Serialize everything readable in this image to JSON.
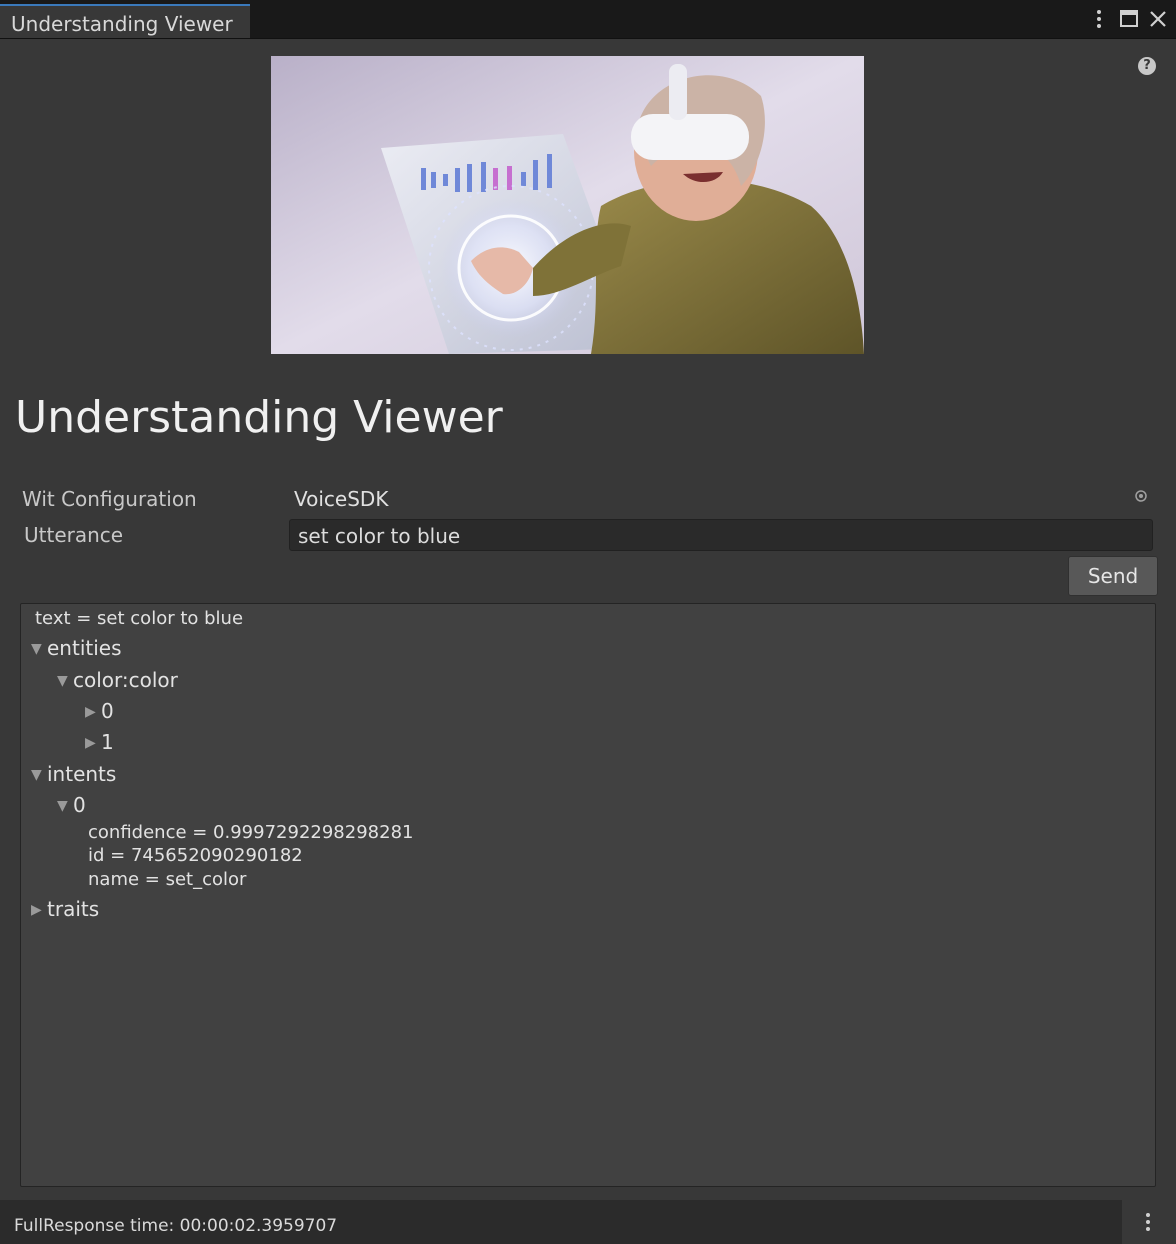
{
  "window": {
    "tab_title": "Understanding Viewer",
    "controls": {
      "menu_icon": "kebab-icon",
      "maximize_icon": "maximize-icon",
      "close_icon": "close-icon"
    }
  },
  "header": {
    "image_icon": "vr-user-hero-image",
    "help_icon": "help-icon",
    "help_glyph": "?"
  },
  "page_title": "Understanding Viewer",
  "form": {
    "wit_configuration_label": "Wit Configuration",
    "wit_configuration_value": "VoiceSDK",
    "utterance_label": "Utterance",
    "utterance_value": "set color to blue",
    "send_label": "Send"
  },
  "response_tree": [
    {
      "label": "text = set color to blue",
      "depth": 0,
      "arrow": "none",
      "kind": "kv"
    },
    {
      "label": "entities",
      "depth": 0,
      "arrow": "expanded",
      "kind": "node"
    },
    {
      "label": "color:color",
      "depth": 1,
      "arrow": "expanded",
      "kind": "node"
    },
    {
      "label": "0",
      "depth": 2,
      "arrow": "collapsed",
      "kind": "node"
    },
    {
      "label": "1",
      "depth": 2,
      "arrow": "collapsed",
      "kind": "node"
    },
    {
      "label": "intents",
      "depth": 0,
      "arrow": "expanded",
      "kind": "node"
    },
    {
      "label": "0",
      "depth": 1,
      "arrow": "expanded",
      "kind": "node"
    },
    {
      "label": "confidence = 0.9997292298298281",
      "depth": 2,
      "arrow": "none",
      "kind": "kv"
    },
    {
      "label": "id = 745652090290182",
      "depth": 2,
      "arrow": "none",
      "kind": "kv"
    },
    {
      "label": "name = set_color",
      "depth": 2,
      "arrow": "none",
      "kind": "kv"
    },
    {
      "label": "traits",
      "depth": 0,
      "arrow": "collapsed",
      "kind": "node"
    }
  ],
  "status_bar": {
    "text": "FullResponse time: 00:00:02.3959707",
    "menu_icon": "kebab-icon"
  },
  "colors": {
    "background": "#383838",
    "tab_accent": "#3a79bb",
    "panel": "#414141",
    "button": "#585858"
  }
}
